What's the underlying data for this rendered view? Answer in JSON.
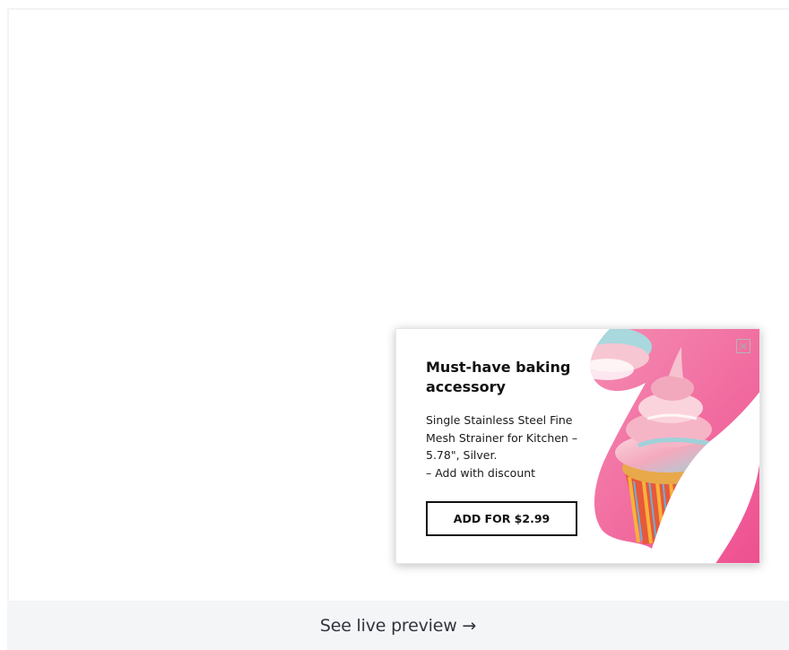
{
  "popup": {
    "title": "Must-have baking accessory",
    "description_lines": [
      "Single Stainless Steel Fine",
      "Mesh Strainer for Kitchen –",
      "5.78\", Silver.",
      "– Add with discount"
    ],
    "cta_label": "ADD FOR $2.99",
    "close_icon": "close-icon",
    "image": "cupcake-image"
  },
  "preview": {
    "link_label": "See live preview →"
  },
  "colors": {
    "pink_background": "#f06aa0",
    "frosting_pink": "#f4b8c8",
    "frosting_blue": "#8ecdd6",
    "cta_border": "#111111",
    "preview_bar": "#f4f5f7"
  }
}
